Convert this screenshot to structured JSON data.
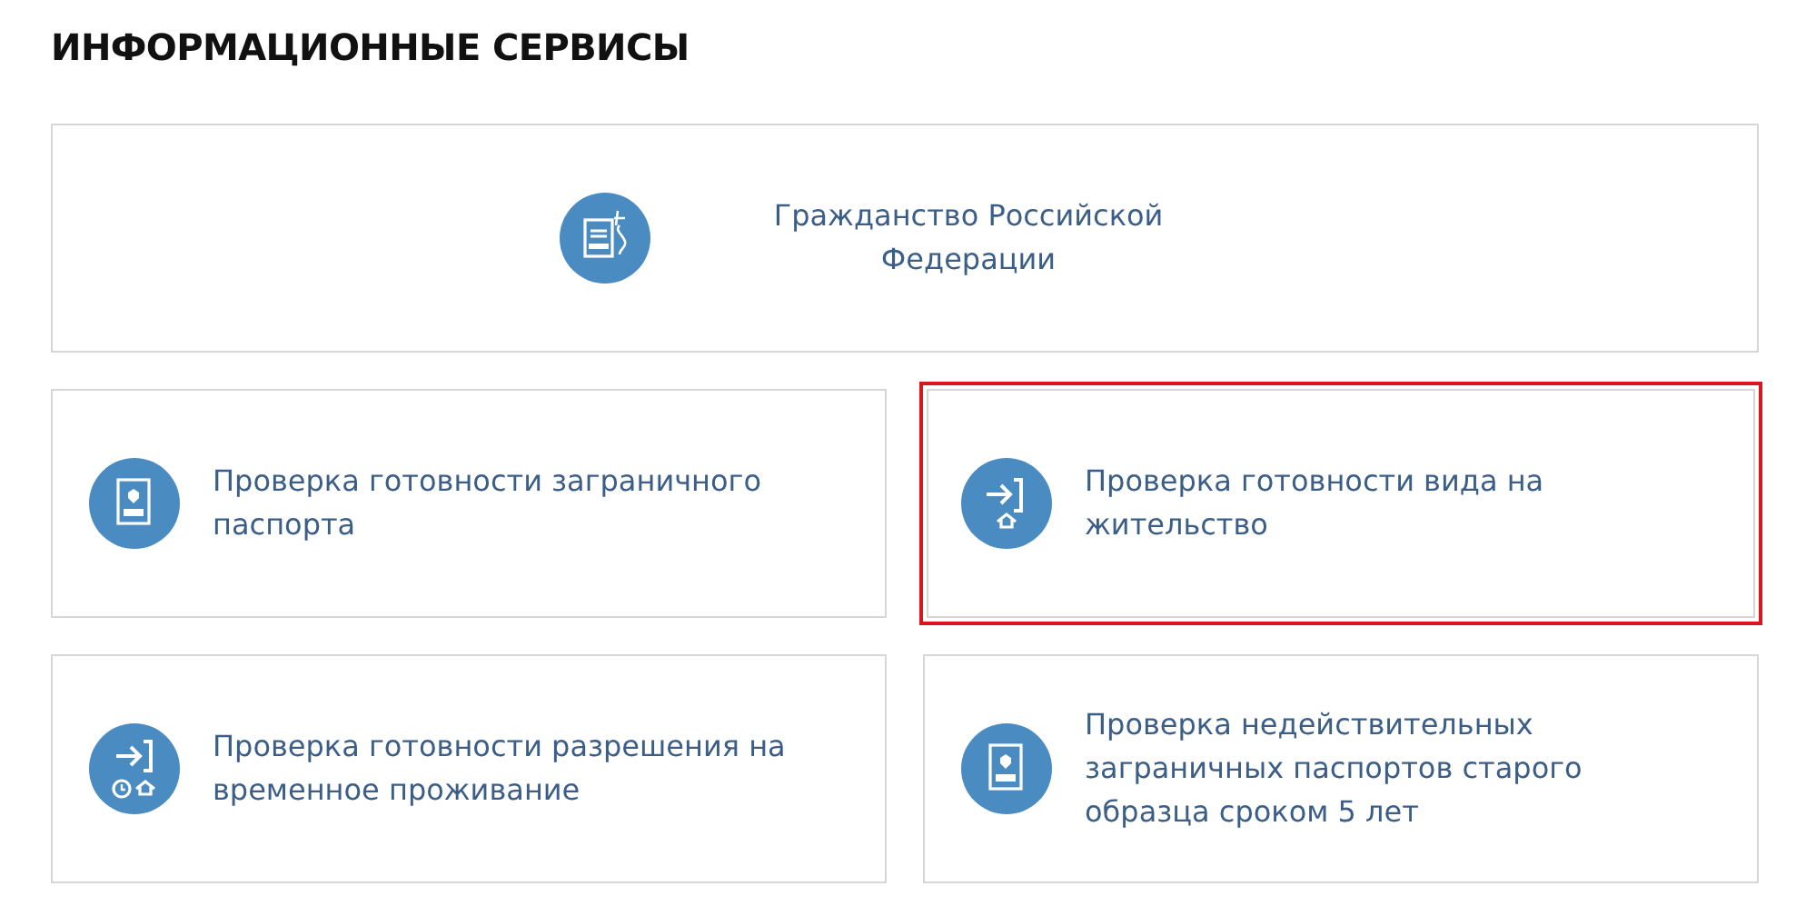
{
  "heading": "ИНФОРМАЦИОННЫЕ СЕРВИСЫ",
  "services": [
    {
      "kind": "citizenship",
      "label": "Гражданство Российской Федерации",
      "wide": true,
      "highlighted": false
    },
    {
      "kind": "passport",
      "label": "Проверка готовности заграничного паспорта",
      "wide": false,
      "highlighted": false
    },
    {
      "kind": "residence",
      "label": "Проверка готовности вида на жительство",
      "wide": false,
      "highlighted": true
    },
    {
      "kind": "temporary",
      "label": "Проверка готовности разрешения на временное проживание",
      "wide": false,
      "highlighted": false
    },
    {
      "kind": "passport",
      "label": "Проверка недействительных заграничных паспортов старого образца сроком 5 лет",
      "wide": false,
      "highlighted": false
    }
  ]
}
